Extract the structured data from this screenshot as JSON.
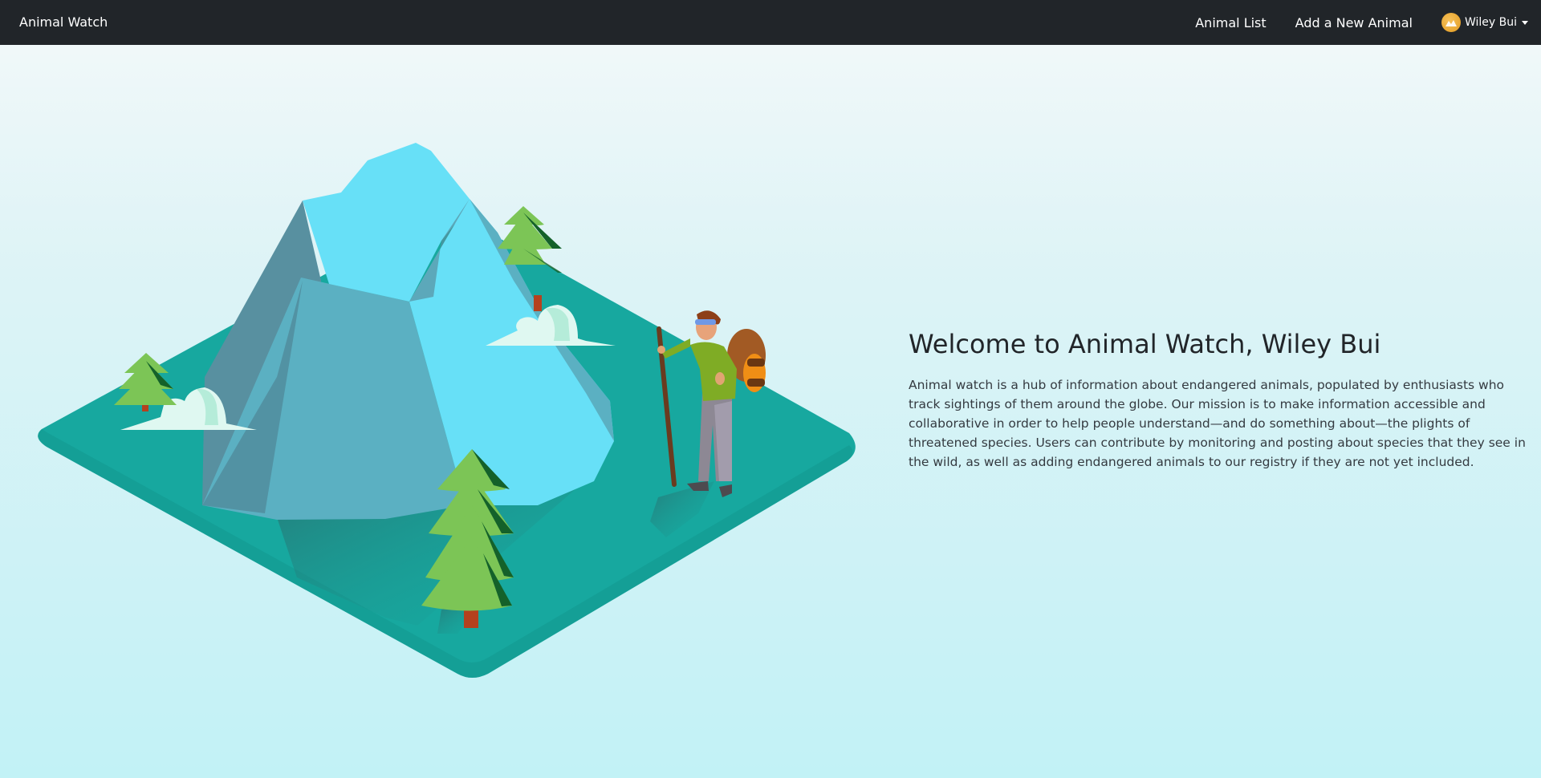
{
  "navbar": {
    "brand": "Animal Watch",
    "links": [
      {
        "label": "Animal List"
      },
      {
        "label": "Add a New Animal"
      }
    ],
    "user": {
      "name": "Wiley Bui",
      "avatar_icon": "user-avatar-icon"
    }
  },
  "hero": {
    "title": "Welcome to Animal Watch, Wiley Bui",
    "description": "Animal watch is a hub of information about endangered animals, populated by enthusiasts who track sightings of them around the globe. Our mission is to make information accessible and collaborative in order to help people understand—and do something about—the plights of threatened species. Users can contribute by monitoring and posting about species that they see in the wild, as well as adding endangered animals to our registry if they are not yet included."
  },
  "colors": {
    "navbar": "#212529",
    "ground": "#17a89f",
    "mountain_light": "#67e0f7",
    "mountain_mid": "#5bb0c2",
    "mountain_dark": "#5890a0",
    "tree": "#7cc556",
    "tree_dark": "#14612a"
  }
}
